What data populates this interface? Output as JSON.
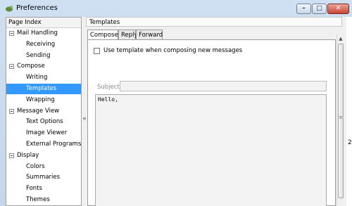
{
  "window": {
    "title": "Preferences",
    "buttons": {
      "minimize": "–",
      "maximize": "□",
      "close": "✕"
    }
  },
  "page_index": {
    "header": "Page Index",
    "categories": [
      {
        "label": "Mail Handling",
        "expanded_glyph": "−",
        "items": [
          "Receiving",
          "Sending"
        ]
      },
      {
        "label": "Compose",
        "expanded_glyph": "−",
        "items": [
          "Writing",
          "Templates",
          "Wrapping"
        ]
      },
      {
        "label": "Message View",
        "expanded_glyph": "−",
        "items": [
          "Text Options",
          "Image Viewer",
          "External Programs"
        ]
      },
      {
        "label": "Display",
        "expanded_glyph": "−",
        "items": [
          "Colors",
          "Summaries",
          "Fonts",
          "Themes"
        ]
      }
    ],
    "selected_item": "Templates"
  },
  "panel": {
    "title": "Templates",
    "tabs": [
      "Compose",
      "Reply",
      "Forward"
    ],
    "active_tab": "Compose",
    "use_template_label": "Use template when composing new messages",
    "use_template_checked": false,
    "subject_label": "Subject",
    "subject_value": "",
    "body_text": "Hello,"
  },
  "splitter_grip": "≡",
  "scroll_arrow_up": "▲",
  "desktop_glimpse_char": "2"
}
